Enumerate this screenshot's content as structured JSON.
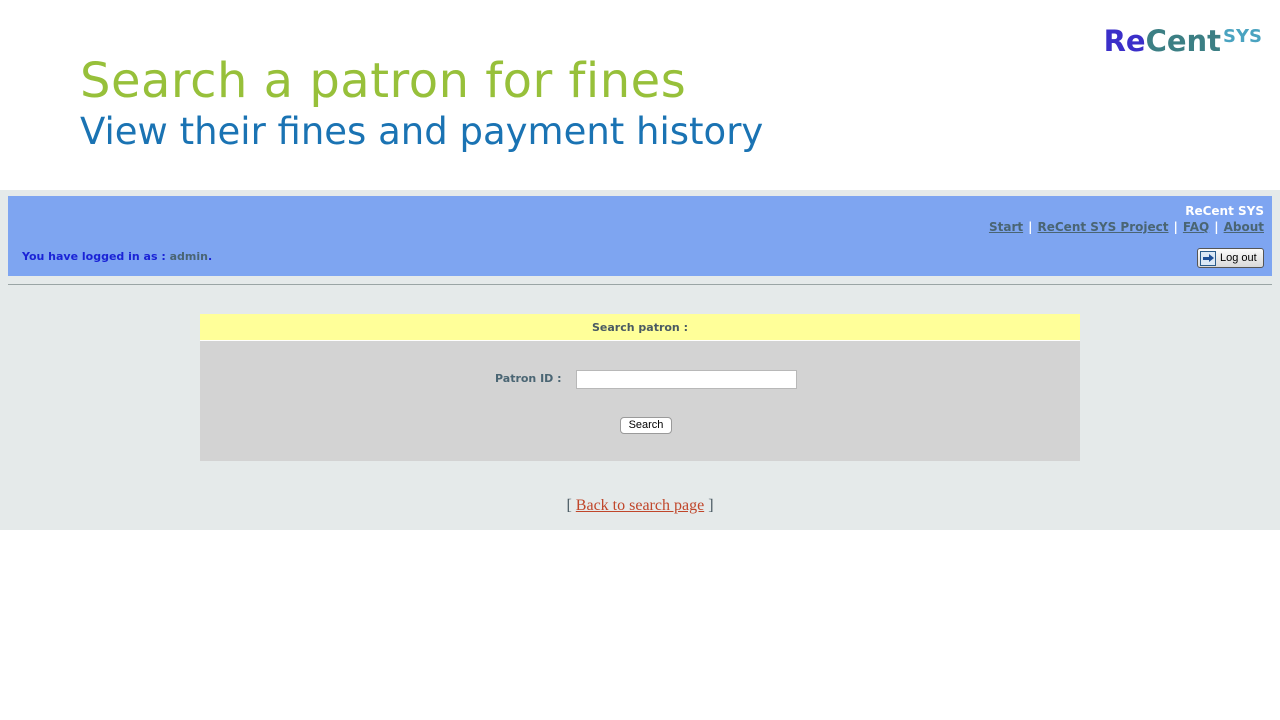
{
  "slide": {
    "title": "Search a patron for fines",
    "subtitle": "View their fines and payment history",
    "logo": {
      "part1": "Re",
      "part2": "Cent",
      "part3": "SYS"
    }
  },
  "header": {
    "brand": "ReCent SYS",
    "nav": [
      {
        "label": "Start"
      },
      {
        "label": "ReCent SYS Project"
      },
      {
        "label": "FAQ"
      },
      {
        "label": "About"
      }
    ],
    "nav_separator": "|",
    "login_prefix": "You have logged in as : ",
    "username": "admin",
    "login_suffix": ".",
    "logout_label": "Log out"
  },
  "search": {
    "panel_title": "Search patron :",
    "patron_id_label": "Patron ID :",
    "patron_id_value": "",
    "search_button": "Search"
  },
  "footer": {
    "open_bracket": "[",
    "back_link": "Back to search page",
    "close_bracket": "]"
  },
  "colors": {
    "title": "#97c03a",
    "subtitle": "#1a73b3",
    "topbar": "#7ea5f1",
    "panel_title_bg": "#ffff99",
    "panel_bg": "#d3d3d3",
    "page_bg": "#e5eaea",
    "link": "#c0462a"
  }
}
